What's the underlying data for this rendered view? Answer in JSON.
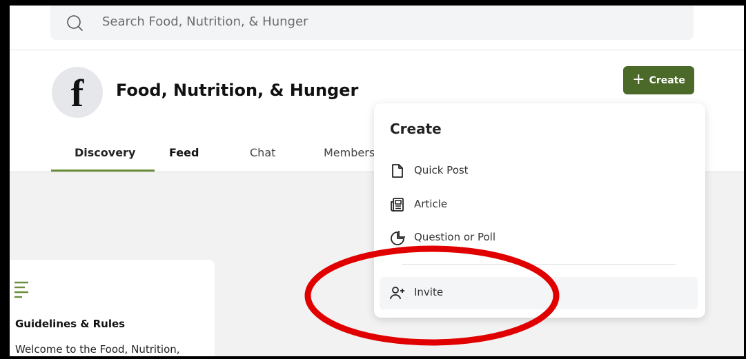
{
  "search": {
    "placeholder": "Search Food, Nutrition, & Hunger"
  },
  "group": {
    "avatar_letter": "f",
    "title": "Food, Nutrition, & Hunger"
  },
  "create_button": {
    "label": "Create"
  },
  "tabs": [
    {
      "label": "Discovery",
      "active": true
    },
    {
      "label": "Feed",
      "active": false
    },
    {
      "label": "Chat",
      "active": false
    },
    {
      "label": "Members",
      "active": false
    }
  ],
  "guidelines": {
    "title": "Guidelines & Rules",
    "text": "Welcome to the Food, Nutrition,"
  },
  "create_menu": {
    "title": "Create",
    "items": [
      {
        "label": "Quick Post",
        "icon": "document-icon"
      },
      {
        "label": "Article",
        "icon": "newspaper-icon"
      },
      {
        "label": "Question or Poll",
        "icon": "pie-chart-icon"
      },
      {
        "label": "Invite",
        "icon": "user-plus-icon"
      }
    ]
  },
  "colors": {
    "accent": "#4b6a2a",
    "tab_underline": "#6b8e3a",
    "annotation": "#e10000"
  }
}
